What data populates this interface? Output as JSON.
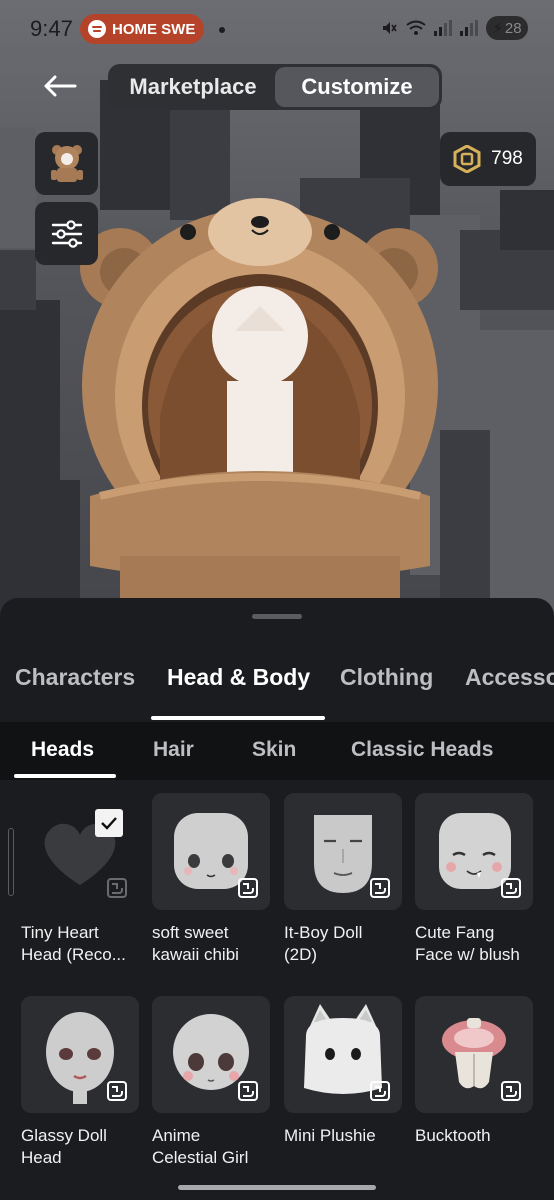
{
  "status_bar": {
    "time": "9:47",
    "media_pill": "HOME SWE",
    "battery": "28"
  },
  "nav": {
    "tabs": [
      "Marketplace",
      "Customize"
    ],
    "active_tab": "Customize",
    "robux_balance": "798"
  },
  "category_tabs": [
    "Characters",
    "Head & Body",
    "Clothing",
    "Accessories"
  ],
  "active_category": "Head & Body",
  "sub_tabs": [
    "Heads",
    "Hair",
    "Skin",
    "Classic Heads"
  ],
  "active_sub_tab": "Heads",
  "items": [
    {
      "line1": "Tiny Heart",
      "line2": "Head (Reco...",
      "selected": true
    },
    {
      "line1": "soft sweet",
      "line2": "kawaii chibi",
      "selected": false
    },
    {
      "line1": "It-Boy Doll",
      "line2": "(2D)",
      "selected": false
    },
    {
      "line1": "Cute Fang",
      "line2": "Face w/ blush",
      "selected": false
    },
    {
      "line1": "Glassy Doll",
      "line2": "Head",
      "selected": false
    },
    {
      "line1": "Anime",
      "line2": "Celestial Girl",
      "selected": false
    },
    {
      "line1": "Mini Plushie",
      "line2": "",
      "selected": false
    },
    {
      "line1": "Bucktooth",
      "line2": "",
      "selected": false
    }
  ],
  "colors": {
    "sheet_bg": "#1b1c20",
    "tile_bg": "#2c2d31",
    "spotify_pill": "#b5432a",
    "robux_gold": "#d7b15a"
  },
  "icons": {
    "back": "arrow-left-icon",
    "filter": "sliders-icon",
    "currency": "robux-icon",
    "face_badge": "face-icon",
    "check": "check-icon"
  }
}
